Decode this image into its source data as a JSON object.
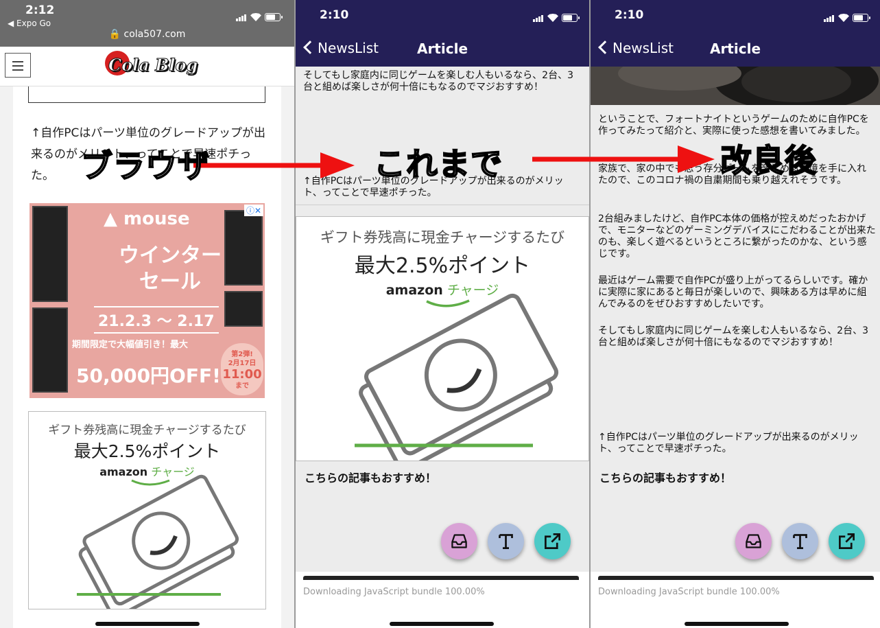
{
  "browser": {
    "status": {
      "time": "2:12",
      "back_app": "◀ Expo Go",
      "url": "🔒 cola507.com"
    },
    "logo": "Cola Blog",
    "paragraph": "↑自作PCはパーツ単位のグレードアップが出来るのがメリット、ってことで早速ポチった。",
    "mouse_ad": {
      "brand": "▲ mouse",
      "sale": "ウインター\nセール",
      "dates": "21.2.3 ～ 2.17",
      "limit": "期間限定で大幅値引き！最大",
      "off": "50,000円OFF!!",
      "stamp_top": "第2弾!\n2月17日",
      "stamp_big": "11:00",
      "stamp_bottom": "まで",
      "badge": "ⓘ✕"
    },
    "amazon_ad": {
      "line1": "ギフト券残高に現金チャージするたび",
      "line2": "最大2.5%ポイント",
      "brand": "amazon",
      "charge": "チャージ"
    }
  },
  "app_before": {
    "status": {
      "time": "2:10"
    },
    "nav": {
      "back_label": "NewsList",
      "title": "Article"
    },
    "text_top": "そしてもし家庭内に同じゲームを楽しむ人もいるなら、2台、3台と組めば楽しさが何十倍にもなるのでマジおすすめ！",
    "text_mid": "↑自作PCはパーツ単位のグレードアップが出来るのがメリット、ってことで早速ポチった。",
    "amazon_ad": {
      "line1": "ギフト券残高に現金チャージするたび",
      "line2": "最大2.5%ポイント",
      "brand": "amazon",
      "charge": "チャージ"
    },
    "section_head": "こちらの記事もおすすめ！",
    "download": "Downloading JavaScript bundle 100.00%"
  },
  "app_after": {
    "status": {
      "time": "2:10"
    },
    "nav": {
      "back_label": "NewsList",
      "title": "Article"
    },
    "paragraphs": [
      "ということで、フォートナイトというゲームのために自作PCを作ってみたって紹介と、実際に使った感想を書いてみました。",
      "家族で、家の中でも思う存分ゲームを楽しめる環境を手に入れたので、このコロナ禍の自粛期間も乗り越えれそうです。",
      "2台組みましたけど、自作PC本体の価格が控えめだったおかげで、モニターなどのゲーミングデバイスにこだわることが出来たのも、楽しく遊べるというところに繋がったのかな、という感じです。",
      "最近はゲーム需要で自作PCが盛り上がってるらしいです。確かに実際に家にあると毎日が楽しいので、興味ある方は早めに組んでみるのをぜひおすすめしたいです。",
      "そしてもし家庭内に同じゲームを楽しむ人もいるなら、2台、3台と組めば楽しさが何十倍にもなるのでマジおすすめ！",
      "↑自作PCはパーツ単位のグレードアップが出来るのがメリット、ってことで早速ポチった。"
    ],
    "section_head": "こちらの記事もおすすめ！",
    "download": "Downloading JavaScript bundle 100.00%"
  },
  "labels": {
    "browser": "ブラウザ",
    "before": "これまで",
    "after": "改良後"
  },
  "colors": {
    "app_bar": "#241f57",
    "arrow": "#ee1111",
    "fab_pink": "#d9a2d6",
    "fab_lavender": "#aebfdc",
    "fab_teal": "#4ecac7",
    "amazon_green": "#5fae47"
  },
  "icons": {
    "fab_1": "inbox-icon",
    "fab_2": "text-icon",
    "fab_3": "open-external-icon"
  }
}
